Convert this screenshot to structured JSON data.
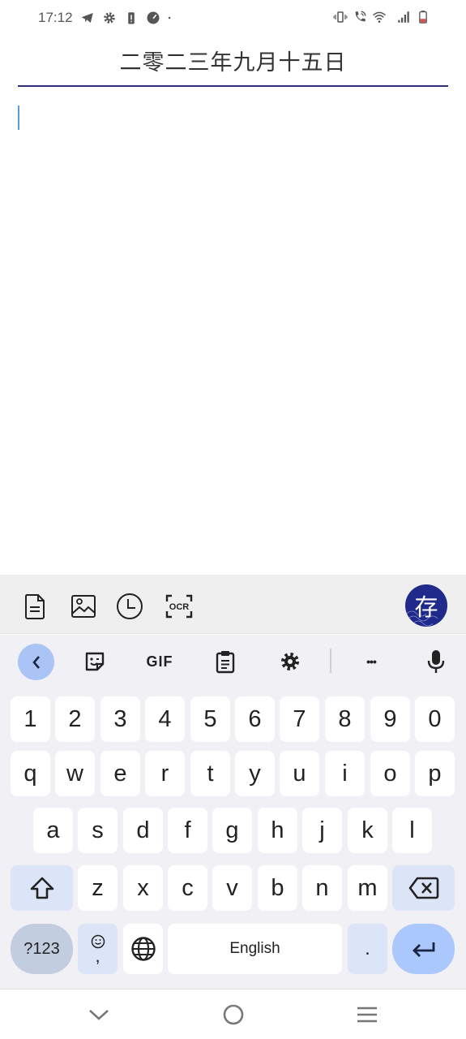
{
  "status_bar": {
    "time": "17:12",
    "left_icons": [
      "telegram-icon",
      "settings-icon",
      "battery-alert-icon",
      "speedometer-icon",
      "dot-icon"
    ],
    "right_icons": [
      "vibrate-icon",
      "wifi-calling-icon",
      "wifi-icon",
      "signal-icon",
      "battery-low-icon"
    ],
    "battery_color": "#d9534f"
  },
  "note": {
    "title": "二零二三年九月十五日",
    "body": "",
    "accent_color": "#2b2f7a"
  },
  "app_toolbar": {
    "items": [
      {
        "name": "document-icon",
        "label": "document"
      },
      {
        "name": "image-icon",
        "label": "image"
      },
      {
        "name": "clock-icon",
        "label": "history"
      },
      {
        "name": "ocr-icon",
        "label": "OCR"
      }
    ],
    "ocr_label": "OCR",
    "save_label": "存",
    "save_color": "#1f2a8a"
  },
  "keyboard": {
    "toolbar": {
      "back_icon": "chevron-left-icon",
      "sticker_icon": "sticker-icon",
      "gif_label": "GIF",
      "clipboard_icon": "clipboard-icon",
      "settings_icon": "gear-icon",
      "more_label": "•••",
      "mic_icon": "microphone-icon"
    },
    "number_row": [
      "1",
      "2",
      "3",
      "4",
      "5",
      "6",
      "7",
      "8",
      "9",
      "0"
    ],
    "row1": [
      "q",
      "w",
      "e",
      "r",
      "t",
      "y",
      "u",
      "i",
      "o",
      "p"
    ],
    "row2": [
      "a",
      "s",
      "d",
      "f",
      "g",
      "h",
      "j",
      "k",
      "l"
    ],
    "row3": [
      "z",
      "x",
      "c",
      "v",
      "b",
      "n",
      "m"
    ],
    "symbols_label": "?123",
    "comma_label": ",",
    "space_label": "English",
    "period_label": "."
  },
  "nav_bar": {
    "back_icon": "chevron-down-icon",
    "home_icon": "circle-home-icon",
    "recents_icon": "menu-icon"
  }
}
